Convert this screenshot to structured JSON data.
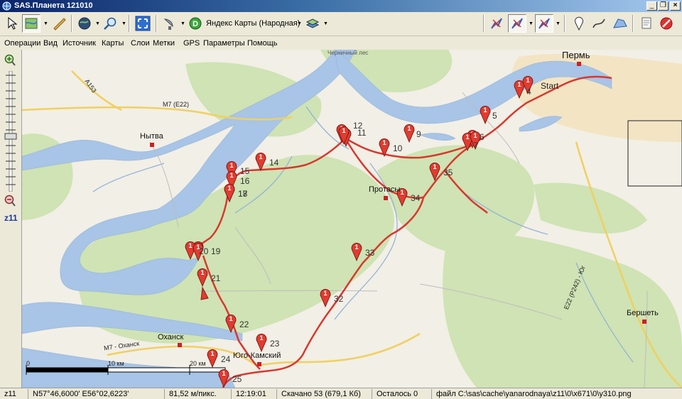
{
  "window": {
    "title": "SAS.Планета 121010"
  },
  "toolbar": {
    "map_source": "Яндекс Карты (Народная)"
  },
  "menu": [
    "Операции",
    "Вид",
    "Источник",
    "Карты",
    "Слои",
    "Метки",
    "GPS",
    "Параметры",
    "Помощь"
  ],
  "zoom": {
    "level": "z11"
  },
  "map": {
    "places": {
      "perm": "Пермь",
      "start": "Start",
      "nytva": "Нытва",
      "protasy": "Протасы",
      "okhansk": "Оханск",
      "yugo_kamsky": "Юго-Камский",
      "bershet": "Бершеть",
      "chernichny": "Черничный лес"
    },
    "roads": {
      "m7_e22": "M7 (E22)",
      "a153": "A153",
      "m7_okhansk": "M7 - Оханск",
      "e22_p242": "E22 (P242) - Юг"
    },
    "scale": {
      "zero": "0",
      "ten": "10 км",
      "twenty": "20 км"
    },
    "marker_glyph": "1",
    "waypoints": [
      "4",
      "5",
      "6",
      "7",
      "9",
      "10",
      "11",
      "12",
      "14",
      "15",
      "16",
      "17",
      "18",
      "19",
      "20",
      "21",
      "22",
      "23",
      "24",
      "25",
      "32",
      "33",
      "34",
      "35"
    ]
  },
  "status": {
    "zoom": "z11",
    "coords": "N57°46,6000' E56°02,6223'",
    "resolution": "81,52 м/пикс.",
    "time": "12:19:01",
    "downloaded": "Скачано 53 (679,1 Кб)",
    "remaining": "Осталось 0",
    "file": "файл C:\\sas\\cache\\yanarodnaya\\z11\\0\\x671\\0\\y310.png"
  },
  "colors": {
    "route": "#d8382e",
    "water": "#a8c4e6",
    "forest": "#cfe3b4",
    "marker": "#e23b2f"
  }
}
